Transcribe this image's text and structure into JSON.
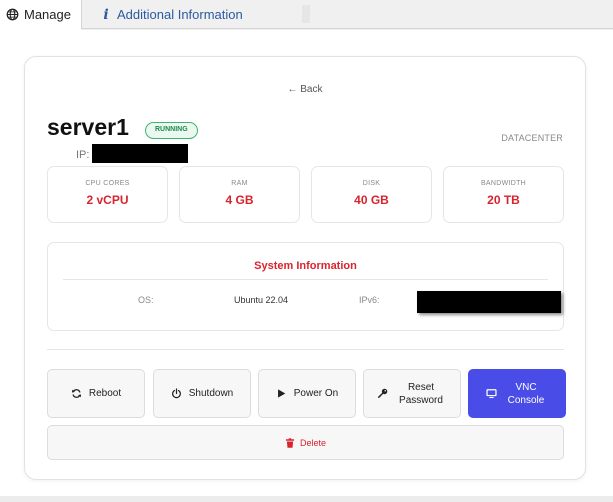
{
  "tabs": {
    "manage": {
      "label": "Manage",
      "icon": "globe-icon"
    },
    "info": {
      "label": "Additional Information",
      "icon": "info-icon"
    }
  },
  "nav": {
    "back_label": "← Back"
  },
  "server": {
    "name": "server1",
    "status": "RUNNING",
    "location": "DATACENTER",
    "ip_label": "IP:"
  },
  "stats": [
    {
      "label": "CPU CORES",
      "value": "2 vCPU"
    },
    {
      "label": "RAM",
      "value": "4 GB"
    },
    {
      "label": "DISK",
      "value": "40 GB"
    },
    {
      "label": "BANDWIDTH",
      "value": "20 TB"
    }
  ],
  "system_info": {
    "title": "System Information",
    "os_label": "OS:",
    "os_value": "Ubuntu 22.04",
    "ipv6_label": "IPv6:"
  },
  "actions": [
    {
      "label": "Reboot",
      "icon": "refresh-icon"
    },
    {
      "label": "Shutdown",
      "icon": "power-icon"
    },
    {
      "label": "Power On",
      "icon": "play-icon"
    },
    {
      "label": "Reset Password",
      "icon": "key-icon"
    },
    {
      "label": "VNC Console",
      "icon": "monitor-icon"
    }
  ],
  "delete": {
    "label": "Delete",
    "icon": "trash-icon"
  },
  "colors": {
    "accent_red": "#d9232e",
    "primary_blue": "#4a4ce8",
    "status_green": "#1f8a4c",
    "link_blue": "#2c5aa0"
  }
}
